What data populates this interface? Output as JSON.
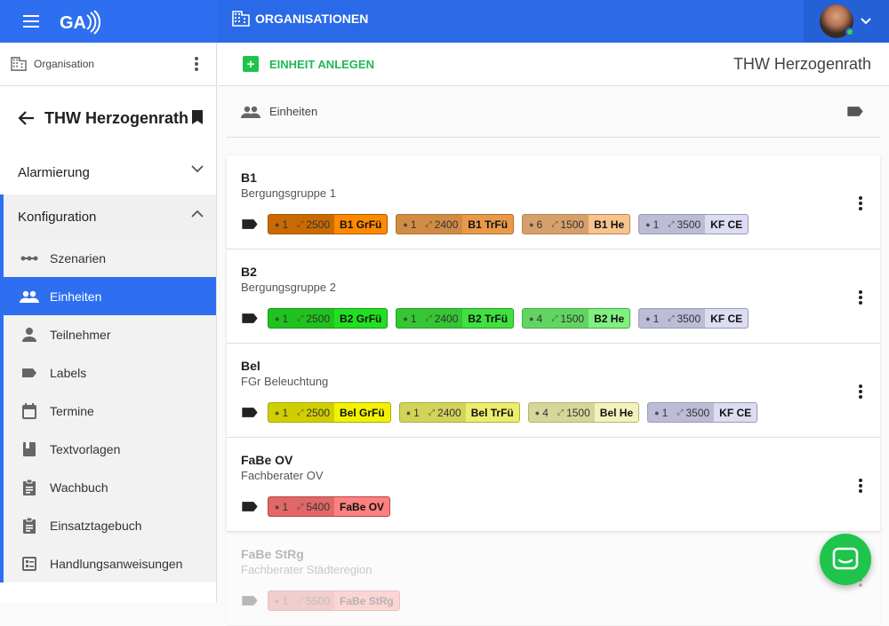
{
  "topbar": {
    "section_title": "ORGANISATIONEN",
    "logo_text": "GA"
  },
  "sidebar": {
    "org_label": "Organisation",
    "title": "THW Herzogenrath",
    "sections": {
      "alarmierung": "Alarmierung",
      "konfiguration": "Konfiguration"
    },
    "items": [
      {
        "label": "Szenarien",
        "icon": "scenario-icon"
      },
      {
        "label": "Einheiten",
        "icon": "people-icon",
        "active": true
      },
      {
        "label": "Teilnehmer",
        "icon": "person-icon"
      },
      {
        "label": "Labels",
        "icon": "label-icon"
      },
      {
        "label": "Termine",
        "icon": "calendar-icon"
      },
      {
        "label": "Textvorlagen",
        "icon": "book-icon"
      },
      {
        "label": "Wachbuch",
        "icon": "clipboard-icon"
      },
      {
        "label": "Einsatztagebuch",
        "icon": "clipboard-icon"
      },
      {
        "label": "Handlungsanweisungen",
        "icon": "checklist-icon"
      }
    ]
  },
  "main": {
    "add_label": "EINHEIT ANLEGEN",
    "org_title": "THW Herzogenrath",
    "units_heading": "Einheiten",
    "units": [
      {
        "name": "B1",
        "subtitle": "Bergungsgruppe 1",
        "chips": [
          {
            "count": "1",
            "dist": "2500",
            "label": "B1 GrFü",
            "bg": "#c96a00",
            "lbg": "#ff8a00",
            "bd": "#a65600"
          },
          {
            "count": "1",
            "dist": "2400",
            "label": "B1 TrFü",
            "bg": "#d08b45",
            "lbg": "#e89a4a",
            "bd": "#b0722f"
          },
          {
            "count": "6",
            "dist": "1500",
            "label": "B1 He",
            "bg": "#d6a06c",
            "lbg": "#f7c48e",
            "bd": "#b98452"
          },
          {
            "count": "1",
            "dist": "3500",
            "label": "KF CE",
            "bg": "#bcbcd6",
            "lbg": "#dcdcf2",
            "bd": "#9a9ab8"
          }
        ]
      },
      {
        "name": "B2",
        "subtitle": "Bergungsgruppe 2",
        "chips": [
          {
            "count": "1",
            "dist": "2500",
            "label": "B2 GrFü",
            "bg": "#1fc21f",
            "lbg": "#21e021",
            "bd": "#139b13"
          },
          {
            "count": "1",
            "dist": "2400",
            "label": "B2 TrFü",
            "bg": "#35c635",
            "lbg": "#3fe03f",
            "bd": "#22a122"
          },
          {
            "count": "4",
            "dist": "1500",
            "label": "B2 He",
            "bg": "#62d462",
            "lbg": "#80f080",
            "bd": "#43ae43"
          },
          {
            "count": "1",
            "dist": "3500",
            "label": "KF CE",
            "bg": "#bcbcd6",
            "lbg": "#dcdcf2",
            "bd": "#9a9ab8"
          }
        ]
      },
      {
        "name": "Bel",
        "subtitle": "FGr Beleuchtung",
        "chips": [
          {
            "count": "1",
            "dist": "2500",
            "label": "Bel GrFü",
            "bg": "#cfcf00",
            "lbg": "#f2f200",
            "bd": "#a8a800"
          },
          {
            "count": "1",
            "dist": "2400",
            "label": "Bel TrFü",
            "bg": "#d3d35a",
            "lbg": "#ecec6e",
            "bd": "#acac3e"
          },
          {
            "count": "4",
            "dist": "1500",
            "label": "Bel He",
            "bg": "#d6d69a",
            "lbg": "#f2f2bc",
            "bd": "#b3b378"
          },
          {
            "count": "1",
            "dist": "3500",
            "label": "KF CE",
            "bg": "#bcbcd6",
            "lbg": "#dcdcf2",
            "bd": "#9a9ab8"
          }
        ]
      },
      {
        "name": "FaBe OV",
        "subtitle": "Fachberater OV",
        "chips": [
          {
            "count": "1",
            "dist": "5400",
            "label": "FaBe OV",
            "bg": "#e06868",
            "lbg": "#ff8080",
            "bd": "#b94444"
          }
        ]
      },
      {
        "name": "FaBe StRg",
        "subtitle": "Fachberater Städteregion",
        "faded": true,
        "chips": [
          {
            "count": "1",
            "dist": "5500",
            "label": "FaBe StRg",
            "bg": "#e06868",
            "lbg": "#ff8080",
            "bd": "#b94444"
          }
        ]
      }
    ]
  },
  "colors": {
    "primary": "#2d6ff0",
    "accent_green": "#1ec44b"
  }
}
